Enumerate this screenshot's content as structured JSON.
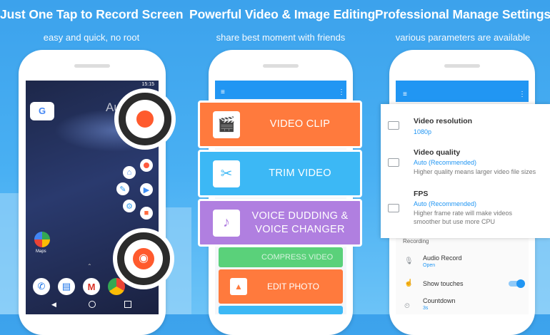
{
  "panels": [
    {
      "title": "Just One Tap to Record Screen",
      "subtitle": "easy and quick, no root"
    },
    {
      "title": "Powerful Video & Image Editing",
      "subtitle": "share best moment with friends"
    },
    {
      "title": "Professional Manage Settings",
      "subtitle": "various parameters are available"
    }
  ],
  "phone1": {
    "status_time": "15:15",
    "google_letter": "G",
    "partial_text": "Au",
    "maps_label": "Maps"
  },
  "editor": {
    "video_clip": "VIDEO CLIP",
    "trim_video": "TRIM VIDEO",
    "voice_dubbing_line1": "VOICE DUDDING &",
    "voice_dubbing_line2": "VOICE CHANGER",
    "compress_video": "COMPRESS VIDEO",
    "edit_photo": "EDIT PHOTO",
    "colors": {
      "orange": "#ff7a3d",
      "blue": "#3cb8f5",
      "purple": "#b07fe0",
      "green": "#5ad17a"
    }
  },
  "settings": {
    "resolution": {
      "title": "Video resolution",
      "value": "1080p"
    },
    "quality": {
      "title": "Video quality",
      "value": "Auto (Recommended)",
      "desc": "Higher quality means larger video file sizes"
    },
    "fps": {
      "title": "FPS",
      "value": "Auto (Recommended)",
      "desc1": "Higher frame rate will make videos",
      "desc2": "smoother but use more CPU"
    },
    "section_recording": "Recording",
    "audio_record": {
      "title": "Audio Record",
      "value": "Open"
    },
    "show_touches": {
      "title": "Show touches",
      "on": true
    },
    "countdown": {
      "title": "Countdown",
      "value": "3s"
    },
    "accent": "#2196f3"
  }
}
